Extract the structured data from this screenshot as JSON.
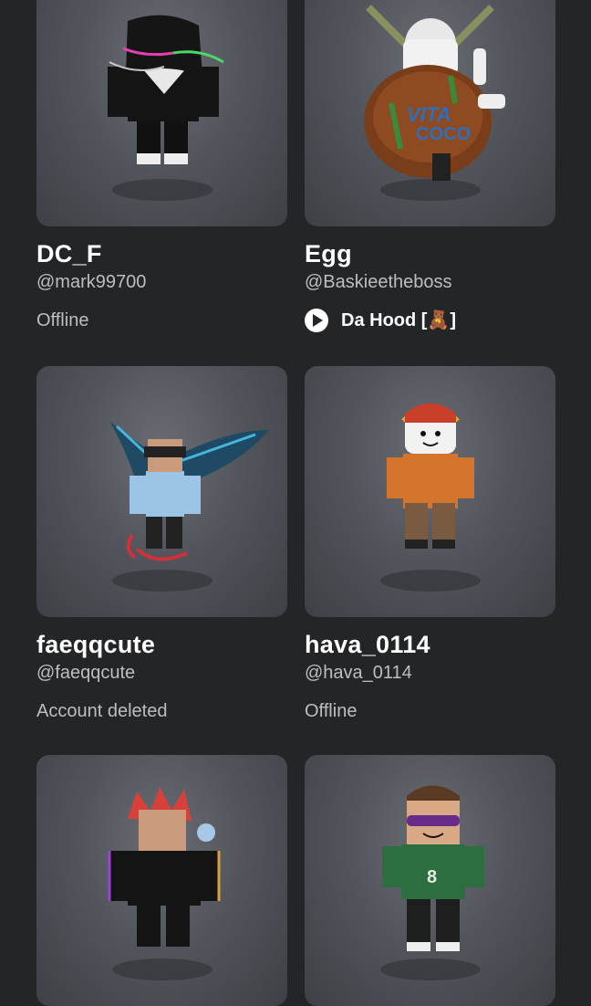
{
  "friends": [
    {
      "display_name": "DC_F",
      "username": "@mark99700",
      "status": "Offline",
      "avatar": "avatar-black-hair-icon"
    },
    {
      "display_name": "Egg",
      "username": "@Baskieetheboss",
      "status": "Da Hood [🧸]",
      "status_type": "in-game",
      "avatar": "avatar-coconut-icon"
    },
    {
      "display_name": "faeqqcute",
      "username": "@faeqqcute",
      "status": "Account deleted",
      "avatar": "avatar-winged-icon"
    },
    {
      "display_name": "hava_0114",
      "username": "@hava_0114",
      "status": "Offline",
      "avatar": "avatar-orange-jacket-icon"
    },
    {
      "display_name": "",
      "username": "",
      "status": "",
      "avatar": "avatar-red-hair-icon"
    },
    {
      "display_name": "",
      "username": "",
      "status": "",
      "avatar": "avatar-green-shirt-icon"
    }
  ],
  "colors": {
    "background": "#232527",
    "card": "#52565c",
    "text_primary": "#ffffff",
    "text_secondary": "#bdbec0"
  }
}
